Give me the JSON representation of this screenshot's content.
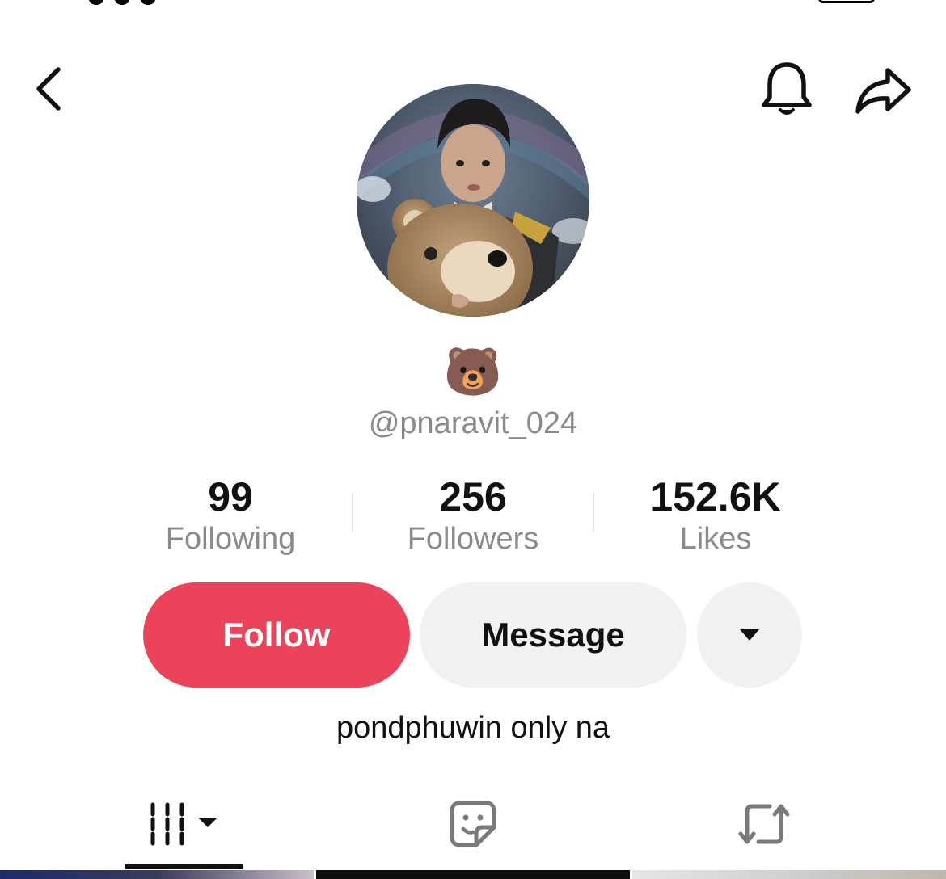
{
  "header": {
    "back_icon": "chevron-left-icon",
    "bell_icon": "bell-icon",
    "share_icon": "share-arrow-icon"
  },
  "profile": {
    "nickname": "🐻",
    "username": "@pnaravit_024",
    "bio": "pondphuwin only na"
  },
  "stats": [
    {
      "value": "99",
      "label": "Following"
    },
    {
      "value": "256",
      "label": "Followers"
    },
    {
      "value": "152.6K",
      "label": "Likes"
    }
  ],
  "actions": {
    "follow_label": "Follow",
    "message_label": "Message",
    "more_icon": "caret-down-icon"
  },
  "tabs": [
    {
      "name": "videos",
      "icon": "grid-bars-icon",
      "active": true
    },
    {
      "name": "liked",
      "icon": "sticker-icon",
      "active": false
    },
    {
      "name": "reposts",
      "icon": "repost-icon",
      "active": false
    }
  ],
  "colors": {
    "follow": "#ea435a",
    "secondary_button": "#f1f1f1",
    "muted_text": "#8a8a8a"
  }
}
